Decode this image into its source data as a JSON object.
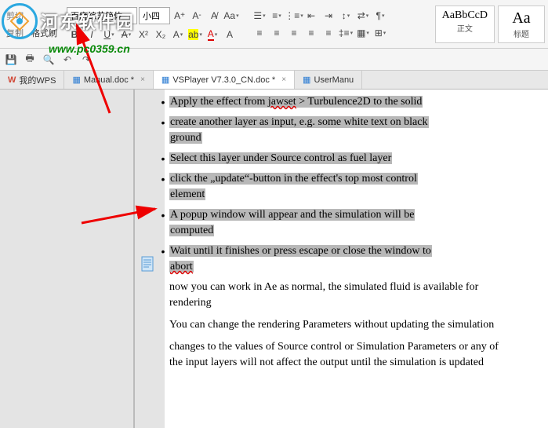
{
  "ribbon": {
    "cut": "剪切",
    "copy": "复制",
    "formatPainter": "格式刷",
    "fontName": "百度综艺简体",
    "fontSize": "小四"
  },
  "styles": {
    "normal": {
      "preview": "AaBbCcD",
      "label": "正文"
    },
    "heading": {
      "preview": "Aa",
      "label": "标题"
    }
  },
  "tabs": {
    "wps": "我的WPS",
    "manual": "Manual.doc *",
    "vsplayer": "VSPlayer V7.3.0_CN.doc *",
    "usermanual": "UserManu"
  },
  "content": {
    "b1": "Apply the effect from ",
    "b1_jawset": "jawset",
    "b1_rest": " > Turbulence2D to the solid",
    "b2a": "create another layer as input, e.g. some white text on black",
    "b2b": "ground",
    "b3": "Select this layer under Source control as fuel layer",
    "b4a": "click the „update“-button in the effect's top most control",
    "b4b": "element",
    "b5a": "A popup window will appear and the simulation will be",
    "b5b": "computed",
    "b6a": "Wait until it finishes or press escape or close the window to",
    "b6_abort": "abort",
    "p1": "now you can work in Ae as normal, the simulated fluid is available for rendering",
    "p2": "You can change the rendering Parameters without updating the simulation",
    "p3": "changes to the values of  Source control or Simulation Parameters or any of  the input layers will not affect the output until the simulation is updated"
  },
  "watermark": {
    "text": "河东软件园",
    "url": "www.pc0359.cn"
  }
}
